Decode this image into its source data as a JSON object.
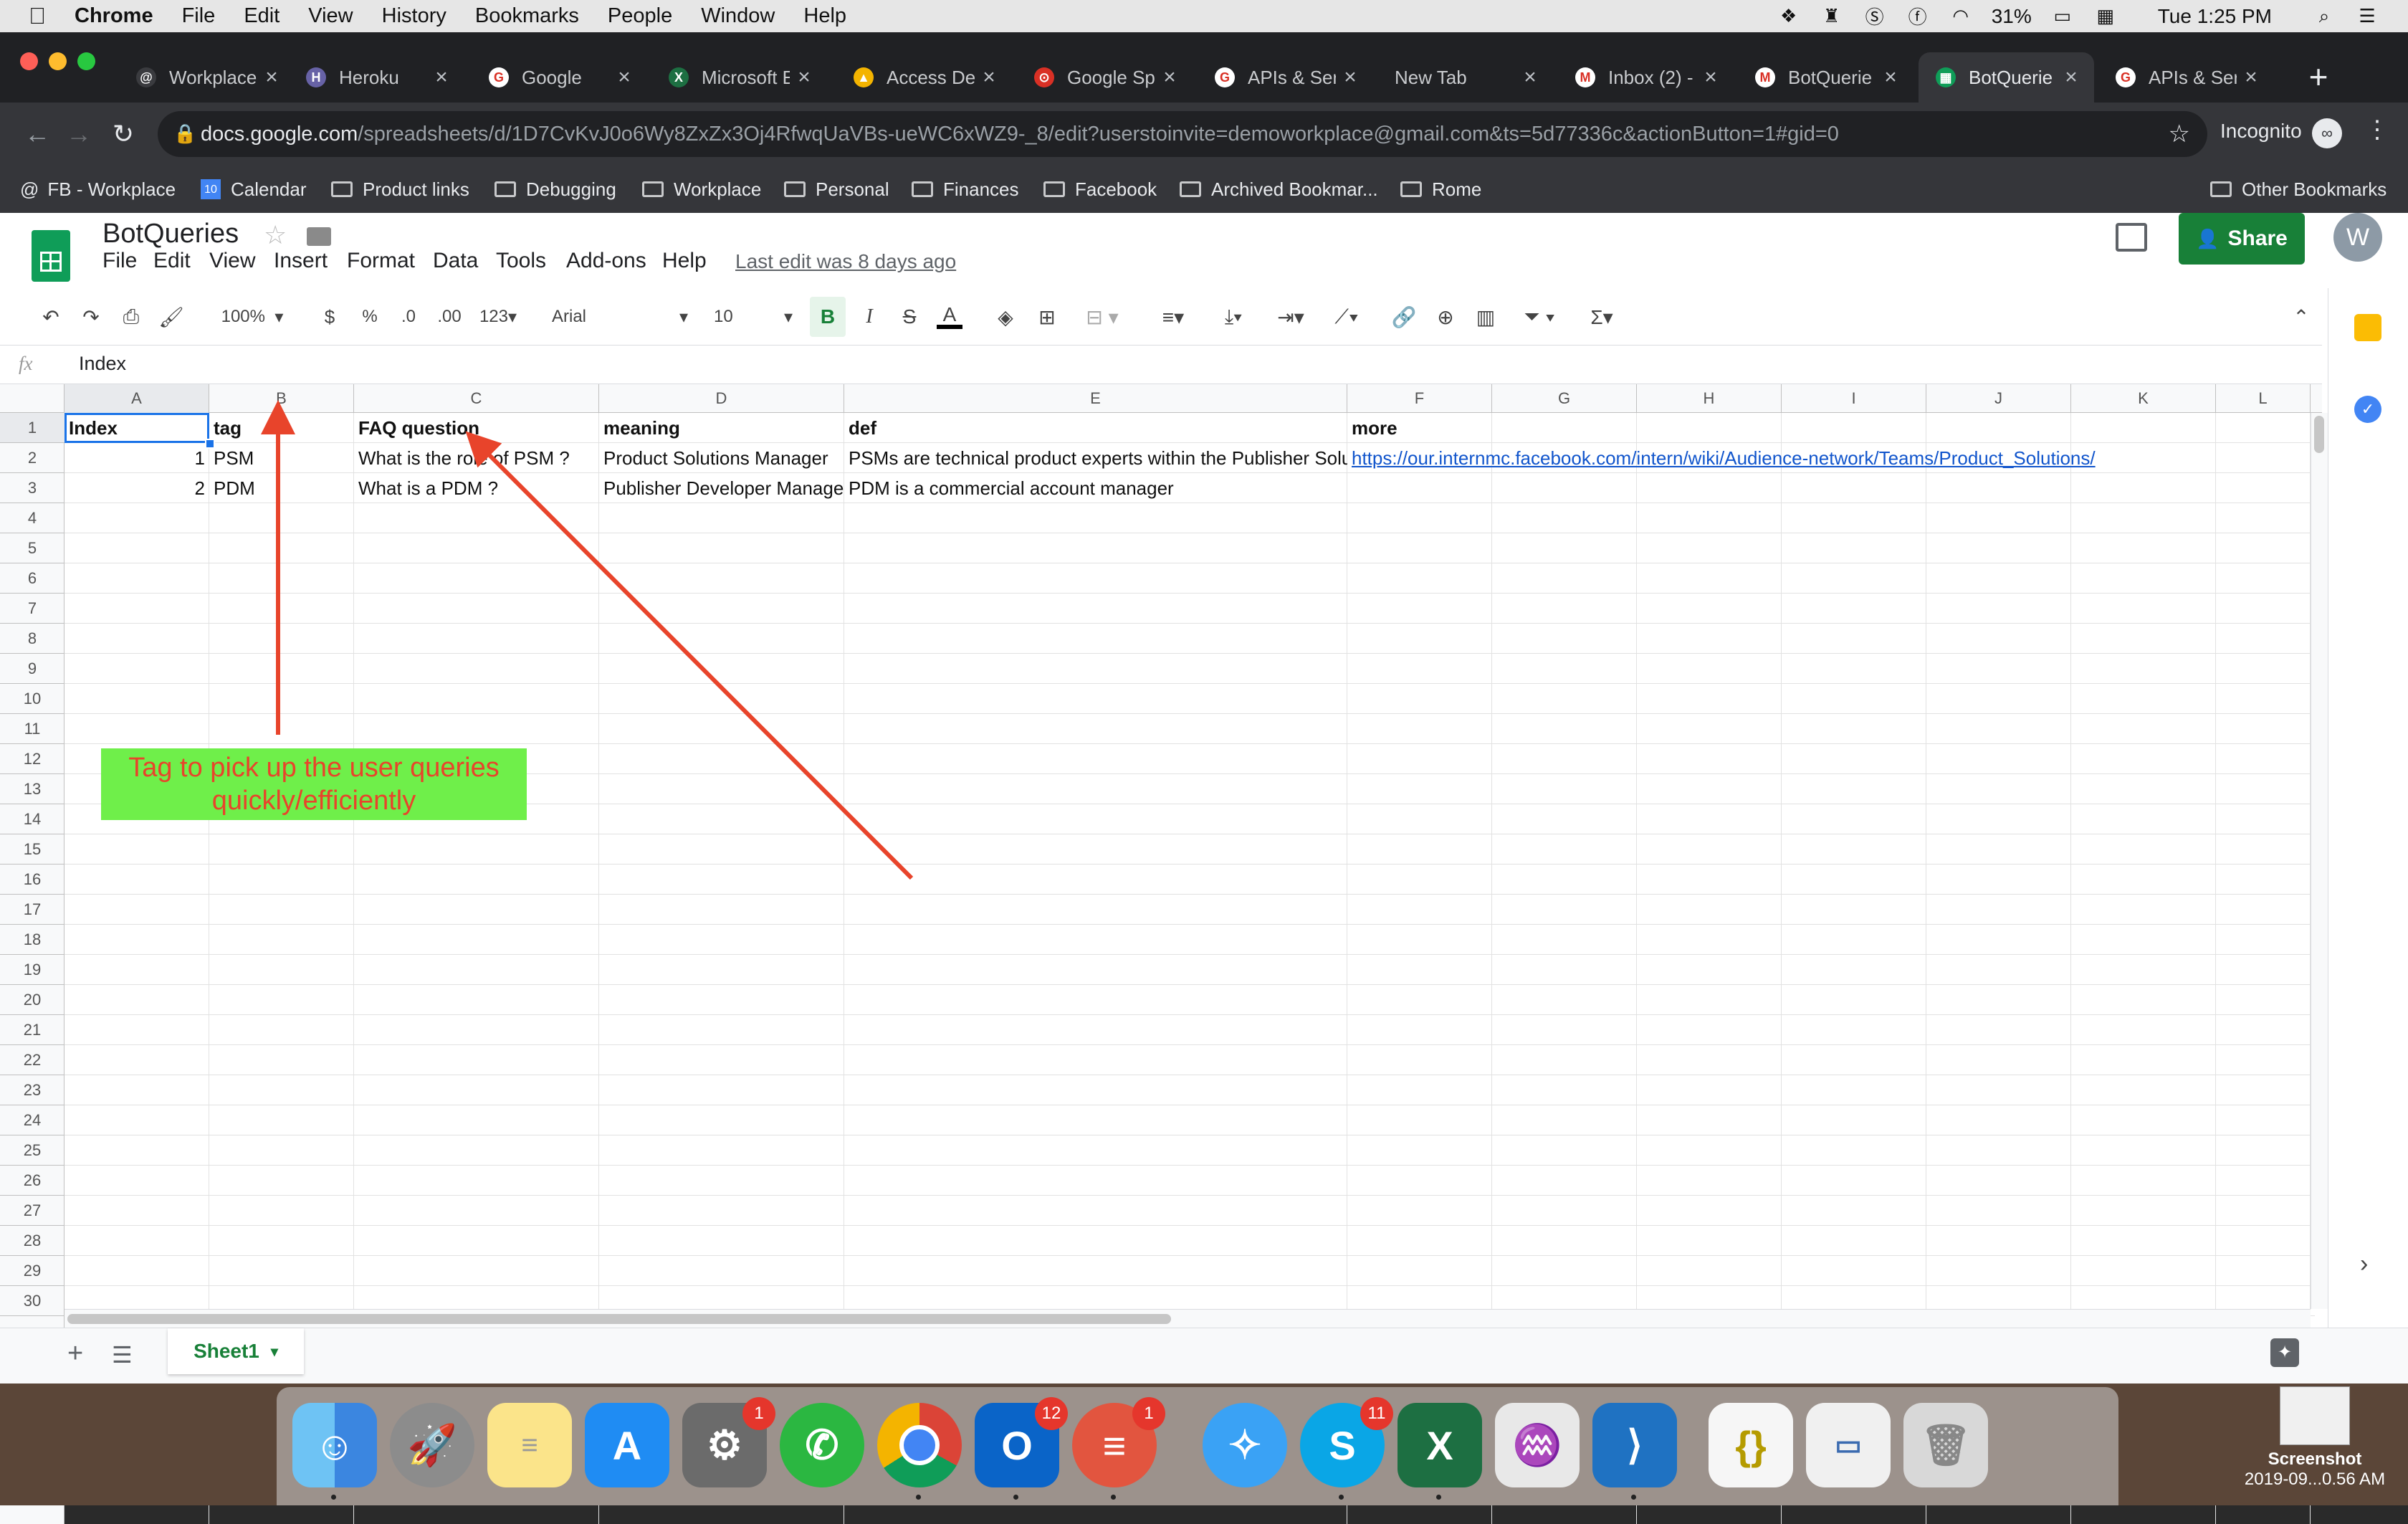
{
  "menubar": {
    "app": "Chrome",
    "items": [
      "File",
      "Edit",
      "View",
      "History",
      "Bookmarks",
      "People",
      "Window",
      "Help"
    ],
    "battery": "31%",
    "clock": "Tue 1:25 PM"
  },
  "tabs": [
    {
      "title": "Workplace",
      "fav_color": "#3a3b3f",
      "fav_glyph": "@"
    },
    {
      "title": "Heroku",
      "fav_color": "#6762a6",
      "fav_glyph": "H"
    },
    {
      "title": "Google",
      "fav_color": "#ffffff",
      "fav_glyph": "G"
    },
    {
      "title": "Microsoft E",
      "fav_color": "#1d6f42",
      "fav_glyph": "X"
    },
    {
      "title": "Access De",
      "fav_color": "#f4b400",
      "fav_glyph": "▲"
    },
    {
      "title": "Google Sp",
      "fav_color": "#d93025",
      "fav_glyph": "⊙"
    },
    {
      "title": "APIs & Ser",
      "fav_color": "#ffffff",
      "fav_glyph": "G"
    },
    {
      "title": "New Tab",
      "fav_color": "",
      "fav_glyph": ""
    },
    {
      "title": "Inbox (2) -",
      "fav_color": "#ffffff",
      "fav_glyph": "M"
    },
    {
      "title": "BotQuerie",
      "fav_color": "#ffffff",
      "fav_glyph": "M"
    },
    {
      "title": "BotQuerie",
      "fav_color": "#0f9d58",
      "fav_glyph": "▦",
      "active": true
    },
    {
      "title": "APIs & Ser",
      "fav_color": "#ffffff",
      "fav_glyph": "G"
    }
  ],
  "omnibox": {
    "host": "docs.google.com",
    "path": "/spreadsheets/d/1D7CvKvJ0o6Wy8ZxZx3Oj4RfwqUaVBs-ueWC6xWZ9-_8/edit?userstoinvite=demoworkplace@gmail.com&ts=5d77336c&actionButton=1#gid=0",
    "profile": "Incognito"
  },
  "bookmarks": [
    "FB - Workplace",
    "Calendar",
    "Product links",
    "Debugging",
    "Workplace",
    "Personal",
    "Finances",
    "Facebook",
    "Archived Bookmar...",
    "Rome"
  ],
  "other_bookmarks": "Other Bookmarks",
  "doc": {
    "title": "BotQueries",
    "menu": [
      "File",
      "Edit",
      "View",
      "Insert",
      "Format",
      "Data",
      "Tools",
      "Add-ons",
      "Help"
    ],
    "last_edit": "Last edit was 8 days ago",
    "share": "Share",
    "avatar": "W"
  },
  "toolbar": {
    "zoom": "100%",
    "currency": "$",
    "percent": "%",
    "dec_less": ".0",
    "dec_more": ".00",
    "format_more": "123",
    "font": "Arial",
    "font_size": "10",
    "bold": "B",
    "italic": "I",
    "strike": "S",
    "text_color": "A"
  },
  "formula_bar": {
    "fx": "fx",
    "value": "Index"
  },
  "columns": [
    "A",
    "B",
    "C",
    "D",
    "E",
    "F",
    "G",
    "H",
    "I",
    "J",
    "K",
    "L"
  ],
  "row_count": 30,
  "cells": {
    "r1": [
      "Index",
      "tag",
      "FAQ question",
      "meaning",
      "def",
      "more"
    ],
    "r2": [
      "1",
      "PSM",
      "What is the role of PSM ?",
      "Product Solutions Manager",
      "PSMs are technical product experts within the Publisher Solu",
      "https://our.internmc.facebook.com/intern/wiki/Audience-network/Teams/Product_Solutions/"
    ],
    "r3": [
      "2",
      "PDM",
      "What is a PDM ?",
      "Publisher Developer Manage",
      "PDM is a commercial account manager",
      ""
    ]
  },
  "annotation": {
    "text": "Tag to pick up the user queries quickly/efficiently",
    "bg_color": "#6fef4a",
    "text_color": "#e8442b",
    "arrow_color": "#e8442b"
  },
  "sheet_tab": "Sheet1",
  "dock": {
    "badges": {
      "sysprefs": "1",
      "outlook": "12",
      "speaker": "1",
      "skype": "11"
    },
    "screenshot_label_1": "Screenshot",
    "screenshot_label_2": "2019-09...0.56 AM"
  }
}
